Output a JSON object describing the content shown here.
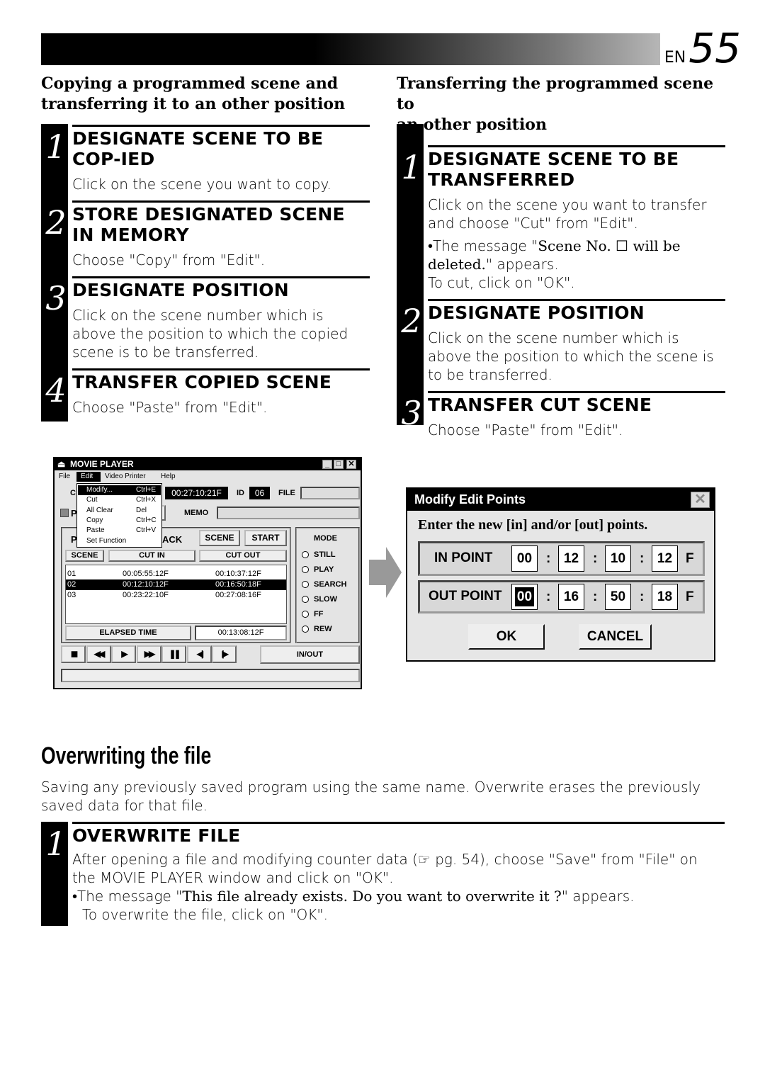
{
  "header": {
    "lang": "EN",
    "page": "55"
  },
  "left": {
    "title_lines": [
      "Copying a programmed scene and",
      "transferring it to an other position"
    ],
    "steps": [
      {
        "num": "1",
        "heading": "DESIGNATE SCENE TO BE COP-IED",
        "text": "Click on the scene you want to copy."
      },
      {
        "num": "2",
        "heading": "STORE DESIGNATED SCENE IN MEMORY",
        "text": "Choose \"Copy\" from \"Edit\"."
      },
      {
        "num": "3",
        "heading": "DESIGNATE POSITION",
        "text": "Click on the scene number which is above the position to which the copied scene is to be transferred."
      },
      {
        "num": "4",
        "heading": "TRANSFER COPIED SCENE",
        "text": "Choose \"Paste\" from \"Edit\"."
      }
    ]
  },
  "right": {
    "title_lines": [
      "Transferring the programmed scene to",
      "an other position"
    ],
    "steps": [
      {
        "num": "1",
        "heading": "DESIGNATE SCENE TO BE TRANSFERRED",
        "text": "Click on the scene you want to transfer and choose \"Cut\" from \"Edit\".",
        "bullet_pre": "•The message \"",
        "bullet_bold": "Scene No. ☐ will be deleted.",
        "bullet_post": "\" appears.",
        "text2": "To cut, click on \"OK\"."
      },
      {
        "num": "2",
        "heading": "DESIGNATE POSITION",
        "text": "Click on the scene number which is above the position to which the scene is to be transferred."
      },
      {
        "num": "3",
        "heading": "TRANSFER CUT SCENE",
        "text": "Choose \"Paste\" from \"Edit\"."
      }
    ]
  },
  "movie_player": {
    "title": "MOVIE PLAYER",
    "menu": [
      "File",
      "Edit",
      "Video Printer",
      "Help"
    ],
    "edit_menu": [
      {
        "label": "Modify...",
        "key": "Ctrl+E"
      },
      {
        "label": "Cut",
        "key": "Ctrl+X"
      },
      {
        "label": "All Clear",
        "key": "Del"
      },
      {
        "label": "Copy",
        "key": "Ctrl+C"
      },
      {
        "label": "Paste",
        "key": "Ctrl+V"
      },
      {
        "label": "Set Function",
        "key": ""
      }
    ],
    "counter": "00:27:10:21F",
    "id_label": "ID",
    "id_value": "06",
    "file_label": "FILE",
    "memo_label": "MEMO",
    "hidden_c": "C",
    "hidden_p": "P",
    "hidden_p2": "P",
    "ack": "ACK",
    "scene_btn": "SCENE",
    "start_btn": "START",
    "columns": [
      "SCENE",
      "CUT IN",
      "CUT OUT"
    ],
    "rows": [
      {
        "scene": "01",
        "in": "00:05:55:12F",
        "out": "00:10:37:12F"
      },
      {
        "scene": "02",
        "in": "00:12:10:12F",
        "out": "00:16:50:18F",
        "selected": true
      },
      {
        "scene": "03",
        "in": "00:23:22:10F",
        "out": "00:27:08:16F"
      }
    ],
    "elapsed_label": "ELAPSED TIME",
    "elapsed_value": "00:13:08:12F",
    "mode_label": "MODE",
    "modes": [
      "STILL",
      "PLAY",
      "SEARCH",
      "SLOW",
      "FF",
      "REW"
    ],
    "transport_icons": [
      "stop-icon",
      "rewind-icon",
      "play-icon",
      "fast-forward-icon",
      "pause-icon",
      "step-back-icon",
      "step-forward-icon"
    ],
    "inout": "IN/OUT"
  },
  "dialog": {
    "title": "Modify Edit Points",
    "message": "Enter the new [in] and/or [out] points.",
    "in_label": "IN POINT",
    "in_values": [
      "00",
      "12",
      "10",
      "12"
    ],
    "out_label": "OUT POINT",
    "out_values": [
      "00",
      "16",
      "50",
      "18"
    ],
    "frame_suffix": "F",
    "separator": ":",
    "ok": "OK",
    "cancel": "CANCEL"
  },
  "overwrite": {
    "title": "Overwriting the file",
    "intro": "Saving any previously saved program using the same name. Overwrite erases the previously saved data for that file.",
    "step": {
      "num": "1",
      "heading": "OVERWRITE FILE",
      "text": "After opening a file and modifying counter data (☞ pg. 54), choose \"Save\" from \"File\" on the MOVIE PLAYER window and click on \"OK\".",
      "bullet_pre": "•The message \"",
      "bullet_bold": "This file already exists. Do you want to overwrite it ?",
      "bullet_post": "\" appears.",
      "text2": "To overwrite the file, click on \"OK\"."
    }
  }
}
